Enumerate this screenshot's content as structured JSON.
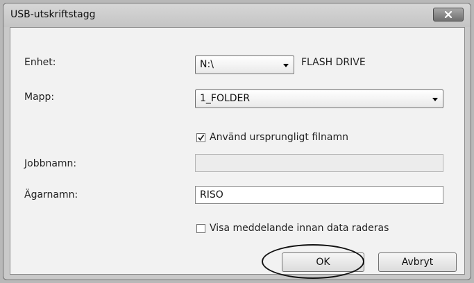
{
  "window": {
    "title": "USB-utskriftstagg"
  },
  "icons": {
    "close": "close-icon",
    "dropdown": "chevron-down-icon",
    "check": "checkmark-icon"
  },
  "form": {
    "device": {
      "label": "Enhet:",
      "value": "N:\\",
      "name": "FLASH DRIVE"
    },
    "folder": {
      "label": "Mapp:",
      "value": "1_FOLDER"
    },
    "use_original_name": {
      "label": "Använd ursprungligt filnamn",
      "checked": true
    },
    "job_name": {
      "label": "Jobbnamn:",
      "value": ""
    },
    "owner_name": {
      "label": "Ägarnamn:",
      "value": "RISO"
    },
    "show_delete_message": {
      "label": "Visa meddelande innan data raderas",
      "checked": false
    }
  },
  "buttons": {
    "ok": "OK",
    "cancel": "Avbryt"
  }
}
